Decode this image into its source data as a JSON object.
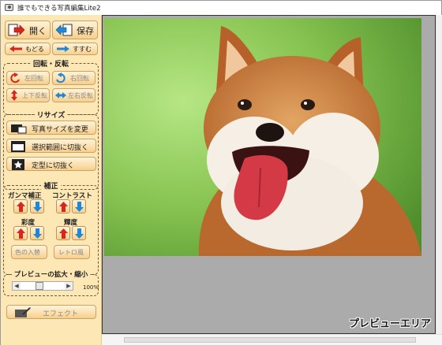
{
  "window": {
    "title": "誰でもできる写真編集Lite2"
  },
  "toolbar": {
    "open_label": "開く",
    "save_label": "保存",
    "undo_label": "もどる",
    "redo_label": "すすむ"
  },
  "rotate": {
    "title": "回転・反転",
    "left_label": "左回転",
    "right_label": "右回転",
    "vflip_label": "上下反転",
    "hflip_label": "左右反転"
  },
  "resize": {
    "title": "リサイズ",
    "change_size_label": "写真サイズを変更",
    "crop_selection_label": "選択範囲に切抜く",
    "crop_shape_label": "定型に切抜く"
  },
  "correction": {
    "title": "補正",
    "gamma_label": "ガンマ補正",
    "contrast_label": "コントラスト",
    "saturation_label": "彩度",
    "brightness_label": "輝度",
    "color_swap_label": "色の入替",
    "retro_label": "レトロ風"
  },
  "zoom": {
    "title": "プレビューの拡大・縮小",
    "value": "100%",
    "level": 0.42
  },
  "effect": {
    "label": "エフェクト"
  },
  "preview": {
    "label": "プレビューエリア"
  },
  "colors": {
    "panel_bg": "#fde7b5",
    "accent_red": "#d9261c",
    "accent_blue": "#1e88d8"
  }
}
